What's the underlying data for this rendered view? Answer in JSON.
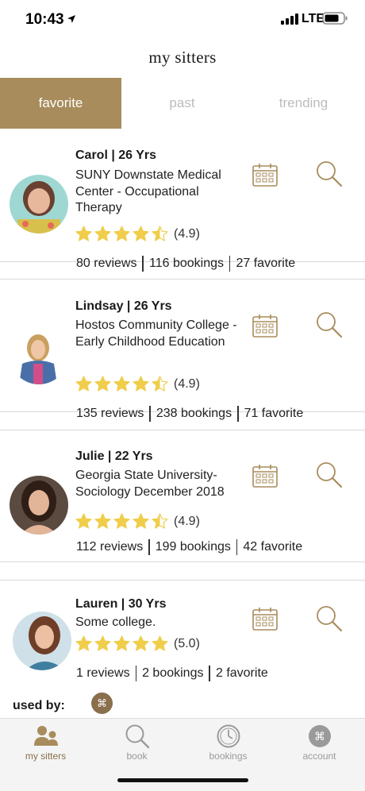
{
  "status_bar": {
    "time": "10:43",
    "network": "LTE"
  },
  "header": {
    "title": "my sitters"
  },
  "tabs": [
    {
      "label": "favorite",
      "active": true
    },
    {
      "label": "past",
      "active": false
    },
    {
      "label": "trending",
      "active": false
    }
  ],
  "sitters": [
    {
      "name": "Carol | 26 Yrs",
      "school": "SUNY Downstate Medical Center - Occupational Therapy",
      "rating": "(4.9)",
      "stars": 4.5,
      "reviews": "80 reviews",
      "bookings": "116 bookings",
      "favorites": "27 favorite"
    },
    {
      "name": "Lindsay | 26 Yrs",
      "school": "Hostos Community College - Early Childhood Education",
      "rating": "(4.9)",
      "stars": 4.5,
      "reviews": "135 reviews",
      "bookings": "238 bookings",
      "favorites": "71 favorite"
    },
    {
      "name": "Julie | 22 Yrs",
      "school": "Georgia State University- Sociology December 2018",
      "rating": "(4.9)",
      "stars": 4.5,
      "reviews": "112 reviews",
      "bookings": "199 bookings",
      "favorites": "42 favorite"
    },
    {
      "name": "Lauren | 30 Yrs",
      "school": "Some college.",
      "rating": "(5.0)",
      "stars": 5,
      "reviews": "1 reviews",
      "bookings": "2 bookings",
      "favorites": "2 favorite"
    }
  ],
  "used_by": {
    "label": "used by:"
  },
  "bottom_nav": [
    {
      "label": "my sitters",
      "icon": "people-icon",
      "active": true
    },
    {
      "label": "book",
      "icon": "search-icon",
      "active": false
    },
    {
      "label": "bookings",
      "icon": "clock-icon",
      "active": false
    },
    {
      "label": "account",
      "icon": "account-icon",
      "active": false
    }
  ],
  "colors": {
    "accent": "#a88c5c",
    "star": "#f0cd4a",
    "icon": "#a88c5c",
    "muted_tab": "#bcbcbc"
  }
}
